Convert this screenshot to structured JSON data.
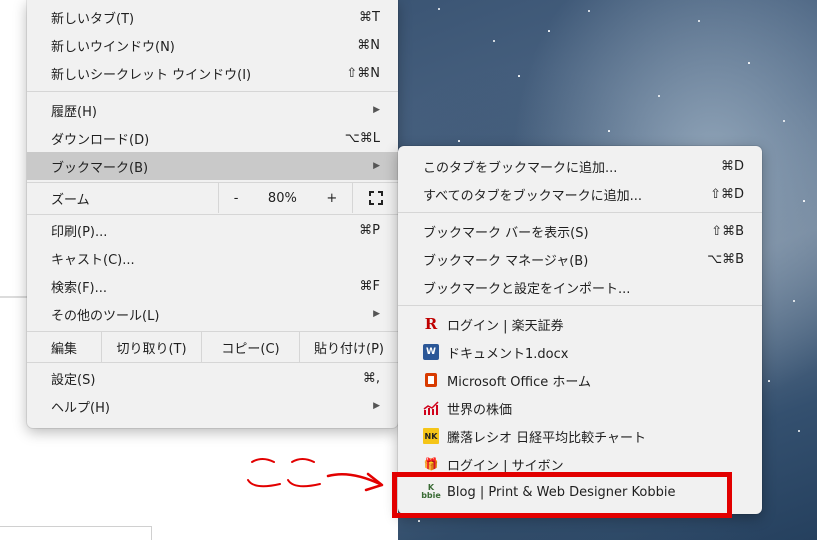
{
  "main_menu": {
    "items": [
      {
        "label": "新しいタブ(T)",
        "shortcut": "⌘T"
      },
      {
        "label": "新しいウインドウ(N)",
        "shortcut": "⌘N"
      },
      {
        "label": "新しいシークレット ウインドウ(I)",
        "shortcut": "⇧⌘N"
      },
      {
        "label": "履歴(H)",
        "shortcut": "▶"
      },
      {
        "label": "ダウンロード(D)",
        "shortcut": "⌥⌘L"
      },
      {
        "label": "ブックマーク(B)",
        "shortcut": "▶"
      },
      {
        "label": "印刷(P)...",
        "shortcut": "⌘P"
      },
      {
        "label": "キャスト(C)...",
        "shortcut": ""
      },
      {
        "label": "検索(F)...",
        "shortcut": "⌘F"
      },
      {
        "label": "その他のツール(L)",
        "shortcut": "▶"
      },
      {
        "label": "設定(S)",
        "shortcut": "⌘,"
      },
      {
        "label": "ヘルプ(H)",
        "shortcut": "▶"
      }
    ],
    "zoom": {
      "label": "ズーム",
      "minus": "-",
      "value": "80%",
      "plus": "+"
    },
    "edit": {
      "label": "編集",
      "cut": "切り取り(T)",
      "copy": "コピー(C)",
      "paste": "貼り付け(P)"
    }
  },
  "bookmark_menu": {
    "items": [
      {
        "label": "このタブをブックマークに追加...",
        "shortcut": "⌘D"
      },
      {
        "label": "すべてのタブをブックマークに追加...",
        "shortcut": "⇧⌘D"
      },
      {
        "label": "ブックマーク バーを表示(S)",
        "shortcut": "⇧⌘B"
      },
      {
        "label": "ブックマーク マネージャ(B)",
        "shortcut": "⌥⌘B"
      },
      {
        "label": "ブックマークと設定をインポート...",
        "shortcut": ""
      }
    ],
    "bookmarks": [
      {
        "label": "ログイン | 楽天証券",
        "icon": "rakuten-icon",
        "glyph": "R"
      },
      {
        "label": "ドキュメント1.docx",
        "icon": "word-doc-icon",
        "glyph": "W"
      },
      {
        "label": "Microsoft Office ホーム",
        "icon": "office-icon",
        "glyph": ""
      },
      {
        "label": "世界の株価",
        "icon": "stock-chart-icon",
        "glyph": ""
      },
      {
        "label": "騰落レシオ 日経平均比較チャート",
        "icon": "nk-icon",
        "glyph": "NK"
      },
      {
        "label": "ログイン | サイボン",
        "icon": "cybon-icon",
        "glyph": "🎁"
      },
      {
        "label": "Blog | Print & Web Designer Kobbie",
        "icon": "kobbie-icon",
        "glyph": "K bbie"
      }
    ]
  },
  "annotation": {
    "text": "ここ",
    "highlight_color": "#e20000"
  }
}
